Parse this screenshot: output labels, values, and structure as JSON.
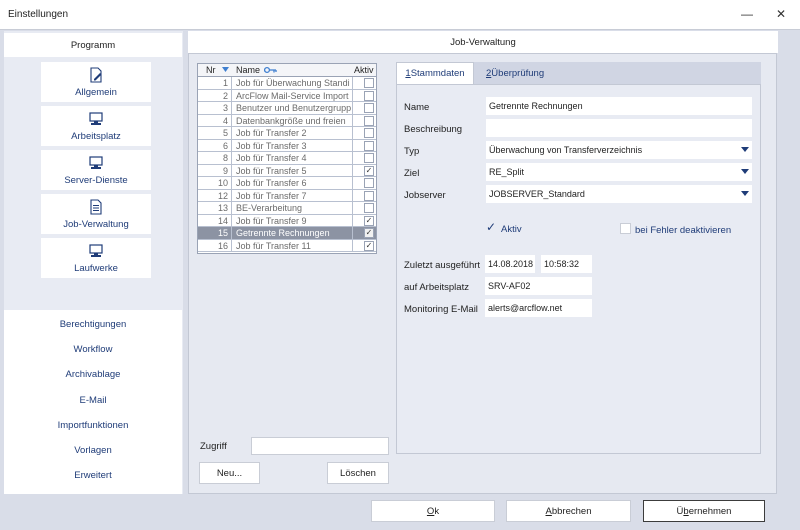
{
  "window": {
    "title": "Einstellungen",
    "minimize_glyph": "—",
    "close_glyph": "✕"
  },
  "sidebar": {
    "header": "Programm",
    "tiles": [
      {
        "label": "Allgemein",
        "icon": "document-edit-icon"
      },
      {
        "label": "Arbeitsplatz",
        "icon": "computer-icon"
      },
      {
        "label": "Server-Dienste",
        "icon": "computer-icon"
      },
      {
        "label": "Job-Verwaltung",
        "icon": "document-icon"
      },
      {
        "label": "Laufwerke",
        "icon": "computer-icon"
      }
    ],
    "links": [
      "Berechtigungen",
      "Workflow",
      "Archivablage",
      "E-Mail",
      "Importfunktionen",
      "Vorlagen",
      "Erweitert"
    ]
  },
  "main": {
    "title": "Job-Verwaltung",
    "grid": {
      "columns": {
        "nr": "Nr",
        "name": "Name",
        "aktiv": "Aktiv"
      },
      "rows": [
        {
          "nr": "1",
          "name": "Job für Überwachung Standi",
          "checked": false
        },
        {
          "nr": "2",
          "name": "ArcFlow Mail-Service Import",
          "checked": false
        },
        {
          "nr": "3",
          "name": "Benutzer und Benutzergrupp",
          "checked": false
        },
        {
          "nr": "4",
          "name": "Datenbankgröße und freien",
          "checked": false
        },
        {
          "nr": "5",
          "name": "Job für Transfer 2",
          "checked": false
        },
        {
          "nr": "6",
          "name": "Job für Transfer 3",
          "checked": false
        },
        {
          "nr": "8",
          "name": "Job für Transfer 4",
          "checked": false
        },
        {
          "nr": "9",
          "name": "Job für Transfer 5",
          "checked": true
        },
        {
          "nr": "10",
          "name": "Job für Transfer 6",
          "checked": false
        },
        {
          "nr": "12",
          "name": "Job für Transfer 7",
          "checked": false
        },
        {
          "nr": "13",
          "name": "BE-Verarbeitung",
          "checked": false
        },
        {
          "nr": "14",
          "name": "Job für Transfer 9",
          "checked": true
        },
        {
          "nr": "15",
          "name": "Getrennte Rechnungen",
          "checked": true,
          "selected": true
        },
        {
          "nr": "16",
          "name": "Job für Transfer 11",
          "checked": true
        }
      ]
    },
    "zugriff_label": "Zugriff",
    "zugriff_value": "",
    "new_button": "Neu...",
    "delete_button": "Löschen",
    "tabs": [
      {
        "key": "1",
        "label": " Stammdaten"
      },
      {
        "key": "2",
        "label": " Überprüfung"
      }
    ],
    "form": {
      "name_label": "Name",
      "name_value": "Getrennte Rechnungen",
      "description_label": "Beschreibung",
      "description_value": "",
      "type_label": "Typ",
      "type_value": "Überwachung von Transferverzeichnis",
      "target_label": "Ziel",
      "target_value": "RE_Split",
      "jobserver_label": "Jobserver",
      "jobserver_value": "JOBSERVER_Standard",
      "active_label": "Aktiv",
      "active_checked": true,
      "disable_on_error_label": "bei Fehler deaktivieren",
      "disable_on_error_checked": false,
      "last_run_label": "Zuletzt ausgeführt",
      "last_run_date": "14.08.2018",
      "last_run_time": "10:58:32",
      "workstation_label": "auf Arbeitsplatz",
      "workstation_value": "SRV-AF02",
      "email_label": "Monitoring E-Mail",
      "email_value": "alerts@arcflow.net"
    }
  },
  "footer": {
    "ok": {
      "key": "O",
      "rest": "k"
    },
    "cancel": {
      "key": "A",
      "rest": "bbrechen"
    },
    "apply": {
      "pre": "Ü",
      "key": "b",
      "rest": "ernehmen"
    }
  },
  "colors": {
    "accent": "#1f3c78",
    "selection": "#8c93a3",
    "panel": "#e8ebf3"
  }
}
